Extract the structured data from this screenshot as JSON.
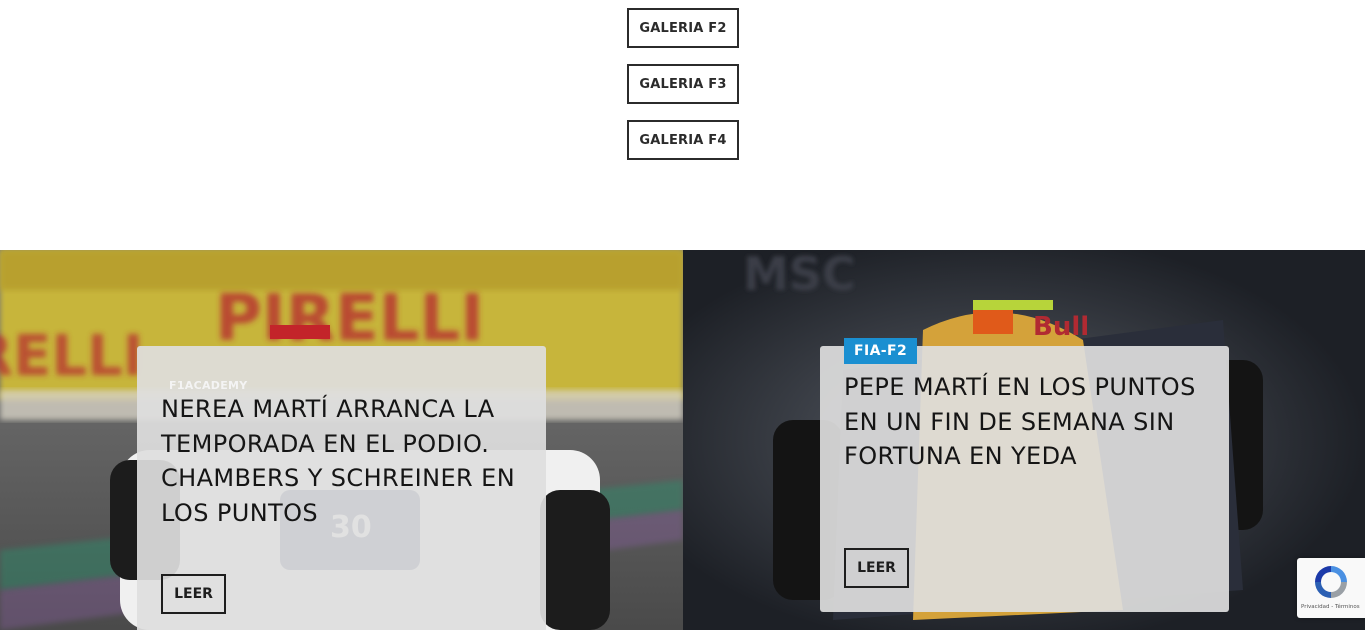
{
  "galleries": [
    {
      "label": "GALERIA F2"
    },
    {
      "label": "GALERIA F3"
    },
    {
      "label": "GALERIA F4"
    }
  ],
  "posts": [
    {
      "category": "F1ACADEMY",
      "title": "NEREA MARTÍ ARRANCA LA TEMPORADA EN EL PODIO. CHAMBERS Y SCHREINER EN LOS PUNTOS",
      "read_label": "LEER",
      "image_text": [
        "PIRELLI",
        "30"
      ]
    },
    {
      "category": "FIA-F2",
      "title": "PEPE MARTÍ EN LOS PUNTOS EN UN FIN DE SEMANA SIN FORTUNA EN YEDA",
      "read_label": "LEER",
      "image_text": [
        "Bull"
      ]
    }
  ],
  "recaptcha": {
    "label": "Privacidad - Términos"
  },
  "colors": {
    "badge": "#1a8fd1",
    "text": "#151515",
    "border": "#2b2b2b"
  }
}
